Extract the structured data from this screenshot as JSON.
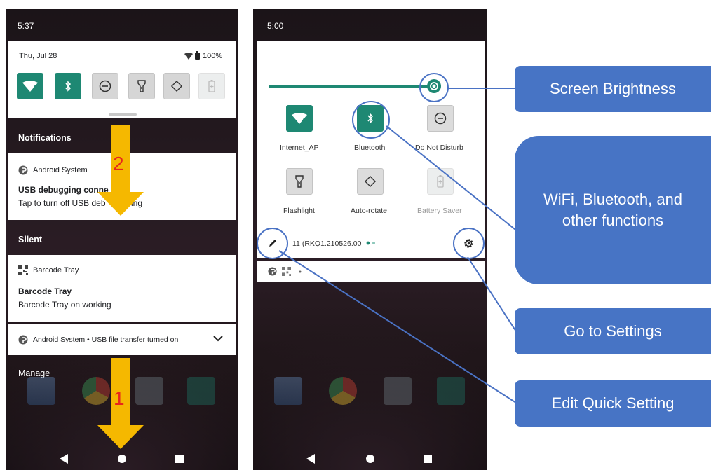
{
  "left": {
    "status_time": "5:37",
    "date": "Thu, Jul 28",
    "battery_pct": "100%",
    "wifi_badge": "4",
    "notifications_header": "Notifications",
    "notif1": {
      "app": "Android System",
      "title": "USB debugging conne",
      "text": "Tap to turn off USB deb",
      "text_end": "ing"
    },
    "silent_header": "Silent",
    "notif2": {
      "app": "Barcode Tray",
      "title": "Barcode Tray",
      "text": "Barcode Tray on working"
    },
    "notif3": {
      "text": "Android System • USB file transfer turned on"
    },
    "manage": "Manage",
    "step2": "2",
    "step1": "1"
  },
  "right": {
    "status_time": "5:00",
    "wifi_badge": "4",
    "brightness_level": 0.9,
    "tiles": [
      {
        "label": "Internet_AP",
        "icon": "wifi-icon",
        "state": "on"
      },
      {
        "label": "Bluetooth",
        "icon": "bluetooth-icon",
        "state": "on"
      },
      {
        "label": "Do Not Disturb",
        "icon": "do-not-disturb-icon",
        "state": "off"
      },
      {
        "label": "Flashlight",
        "icon": "flashlight-icon",
        "state": "off"
      },
      {
        "label": "Auto-rotate",
        "icon": "auto-rotate-icon",
        "state": "off"
      },
      {
        "label": "Battery Saver",
        "icon": "battery-saver-icon",
        "state": "disabled"
      }
    ],
    "build": "11 (RKQ1.210526.00"
  },
  "callouts": {
    "brightness": "Screen Brightness",
    "functions_line1": "WiFi, Bluetooth, and",
    "functions_line2": "other functions",
    "settings": "Go to Settings",
    "edit": "Edit Quick Setting"
  },
  "colors": {
    "accent": "#1e8873",
    "callout": "#4774c5",
    "arrow": "#f5b800",
    "step_number": "#e8261c"
  }
}
